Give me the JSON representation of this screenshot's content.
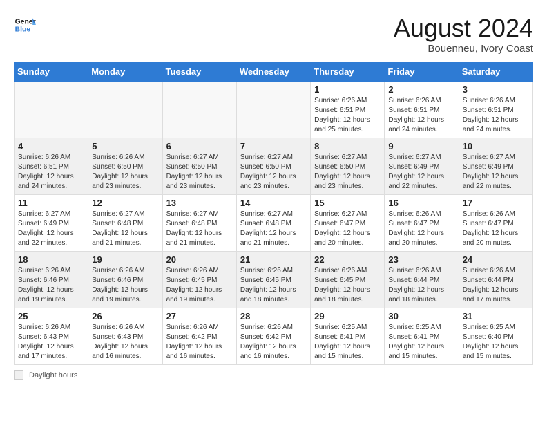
{
  "header": {
    "logo_general": "General",
    "logo_blue": "Blue",
    "month_title": "August 2024",
    "location": "Bouenneu, Ivory Coast"
  },
  "weekdays": [
    "Sunday",
    "Monday",
    "Tuesday",
    "Wednesday",
    "Thursday",
    "Friday",
    "Saturday"
  ],
  "weeks": [
    [
      {
        "day": "",
        "text": "",
        "shaded": true
      },
      {
        "day": "",
        "text": "",
        "shaded": true
      },
      {
        "day": "",
        "text": "",
        "shaded": true
      },
      {
        "day": "",
        "text": "",
        "shaded": true
      },
      {
        "day": "1",
        "text": "Sunrise: 6:26 AM\nSunset: 6:51 PM\nDaylight: 12 hours and 25 minutes.",
        "shaded": false
      },
      {
        "day": "2",
        "text": "Sunrise: 6:26 AM\nSunset: 6:51 PM\nDaylight: 12 hours and 24 minutes.",
        "shaded": false
      },
      {
        "day": "3",
        "text": "Sunrise: 6:26 AM\nSunset: 6:51 PM\nDaylight: 12 hours and 24 minutes.",
        "shaded": false
      }
    ],
    [
      {
        "day": "4",
        "text": "Sunrise: 6:26 AM\nSunset: 6:51 PM\nDaylight: 12 hours and 24 minutes.",
        "shaded": true
      },
      {
        "day": "5",
        "text": "Sunrise: 6:26 AM\nSunset: 6:50 PM\nDaylight: 12 hours and 23 minutes.",
        "shaded": true
      },
      {
        "day": "6",
        "text": "Sunrise: 6:27 AM\nSunset: 6:50 PM\nDaylight: 12 hours and 23 minutes.",
        "shaded": true
      },
      {
        "day": "7",
        "text": "Sunrise: 6:27 AM\nSunset: 6:50 PM\nDaylight: 12 hours and 23 minutes.",
        "shaded": true
      },
      {
        "day": "8",
        "text": "Sunrise: 6:27 AM\nSunset: 6:50 PM\nDaylight: 12 hours and 23 minutes.",
        "shaded": true
      },
      {
        "day": "9",
        "text": "Sunrise: 6:27 AM\nSunset: 6:49 PM\nDaylight: 12 hours and 22 minutes.",
        "shaded": true
      },
      {
        "day": "10",
        "text": "Sunrise: 6:27 AM\nSunset: 6:49 PM\nDaylight: 12 hours and 22 minutes.",
        "shaded": true
      }
    ],
    [
      {
        "day": "11",
        "text": "Sunrise: 6:27 AM\nSunset: 6:49 PM\nDaylight: 12 hours and 22 minutes.",
        "shaded": false
      },
      {
        "day": "12",
        "text": "Sunrise: 6:27 AM\nSunset: 6:48 PM\nDaylight: 12 hours and 21 minutes.",
        "shaded": false
      },
      {
        "day": "13",
        "text": "Sunrise: 6:27 AM\nSunset: 6:48 PM\nDaylight: 12 hours and 21 minutes.",
        "shaded": false
      },
      {
        "day": "14",
        "text": "Sunrise: 6:27 AM\nSunset: 6:48 PM\nDaylight: 12 hours and 21 minutes.",
        "shaded": false
      },
      {
        "day": "15",
        "text": "Sunrise: 6:27 AM\nSunset: 6:47 PM\nDaylight: 12 hours and 20 minutes.",
        "shaded": false
      },
      {
        "day": "16",
        "text": "Sunrise: 6:26 AM\nSunset: 6:47 PM\nDaylight: 12 hours and 20 minutes.",
        "shaded": false
      },
      {
        "day": "17",
        "text": "Sunrise: 6:26 AM\nSunset: 6:47 PM\nDaylight: 12 hours and 20 minutes.",
        "shaded": false
      }
    ],
    [
      {
        "day": "18",
        "text": "Sunrise: 6:26 AM\nSunset: 6:46 PM\nDaylight: 12 hours and 19 minutes.",
        "shaded": true
      },
      {
        "day": "19",
        "text": "Sunrise: 6:26 AM\nSunset: 6:46 PM\nDaylight: 12 hours and 19 minutes.",
        "shaded": true
      },
      {
        "day": "20",
        "text": "Sunrise: 6:26 AM\nSunset: 6:45 PM\nDaylight: 12 hours and 19 minutes.",
        "shaded": true
      },
      {
        "day": "21",
        "text": "Sunrise: 6:26 AM\nSunset: 6:45 PM\nDaylight: 12 hours and 18 minutes.",
        "shaded": true
      },
      {
        "day": "22",
        "text": "Sunrise: 6:26 AM\nSunset: 6:45 PM\nDaylight: 12 hours and 18 minutes.",
        "shaded": true
      },
      {
        "day": "23",
        "text": "Sunrise: 6:26 AM\nSunset: 6:44 PM\nDaylight: 12 hours and 18 minutes.",
        "shaded": true
      },
      {
        "day": "24",
        "text": "Sunrise: 6:26 AM\nSunset: 6:44 PM\nDaylight: 12 hours and 17 minutes.",
        "shaded": true
      }
    ],
    [
      {
        "day": "25",
        "text": "Sunrise: 6:26 AM\nSunset: 6:43 PM\nDaylight: 12 hours and 17 minutes.",
        "shaded": false
      },
      {
        "day": "26",
        "text": "Sunrise: 6:26 AM\nSunset: 6:43 PM\nDaylight: 12 hours and 16 minutes.",
        "shaded": false
      },
      {
        "day": "27",
        "text": "Sunrise: 6:26 AM\nSunset: 6:42 PM\nDaylight: 12 hours and 16 minutes.",
        "shaded": false
      },
      {
        "day": "28",
        "text": "Sunrise: 6:26 AM\nSunset: 6:42 PM\nDaylight: 12 hours and 16 minutes.",
        "shaded": false
      },
      {
        "day": "29",
        "text": "Sunrise: 6:25 AM\nSunset: 6:41 PM\nDaylight: 12 hours and 15 minutes.",
        "shaded": false
      },
      {
        "day": "30",
        "text": "Sunrise: 6:25 AM\nSunset: 6:41 PM\nDaylight: 12 hours and 15 minutes.",
        "shaded": false
      },
      {
        "day": "31",
        "text": "Sunrise: 6:25 AM\nSunset: 6:40 PM\nDaylight: 12 hours and 15 minutes.",
        "shaded": false
      }
    ]
  ],
  "footer": {
    "legend_label": "Daylight hours"
  }
}
